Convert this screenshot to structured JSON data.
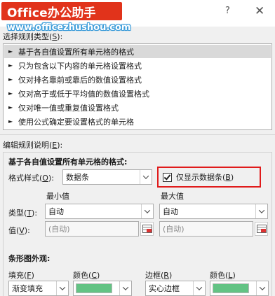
{
  "window": {
    "logo_text": "Office办公助手",
    "watermark": "www.officezhushou.com",
    "help_glyph": "?",
    "close_glyph": "✕"
  },
  "rule_type": {
    "label": "选择规则类型(S):",
    "items": [
      {
        "label": "基于各自值设置所有单元格的格式",
        "selected": true
      },
      {
        "label": "只为包含以下内容的单元格设置格式",
        "selected": false
      },
      {
        "label": "仅对排名靠前或靠后的数值设置格式",
        "selected": false
      },
      {
        "label": "仅对高于或低于平均值的数值设置格式",
        "selected": false
      },
      {
        "label": "仅对唯一值或重复值设置格式",
        "selected": false
      },
      {
        "label": "使用公式确定要设置格式的单元格",
        "selected": false
      }
    ],
    "arrow_glyph": "►"
  },
  "edit_rule": {
    "label": "编辑规则说明(E):",
    "heading": "基于各自值设置所有单元格的格式:",
    "format_style_label": "格式样式(O):",
    "format_style_value": "数据条",
    "show_bar_only_label": "仅显示数据条(B)",
    "show_bar_only_checked": true,
    "min_header": "最小值",
    "max_header": "最大值",
    "type_label": "类型(T):",
    "min_type": "自动",
    "max_type": "自动",
    "value_label": "值(V):",
    "min_value": "(自动)",
    "max_value": "(自动)",
    "bar_appearance_heading": "条形图外观:",
    "fill_label": "填充(F)",
    "fill_color_label": "颜色(C)",
    "border_label": "边框(R)",
    "border_color_label": "颜色(L)",
    "fill_value": "渐变填充",
    "border_value": "实心边框",
    "fill_color": "#63c384",
    "border_color": "#63c384"
  },
  "colors": {
    "logo_bg": "#e1331b",
    "highlight_border": "#e01b1b",
    "selected_row": "#d9d9d9"
  }
}
